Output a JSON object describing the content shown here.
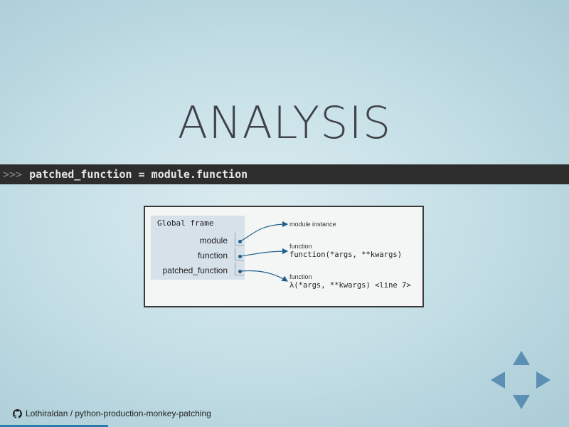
{
  "slide": {
    "title": "ANALYSIS",
    "code": {
      "prompt": ">>>",
      "text": "patched_function = module.function"
    },
    "diagram": {
      "frame_title": "Global frame",
      "variables": [
        "module",
        "function",
        "patched_function"
      ],
      "objects": [
        {
          "type_label": "",
          "value": "module instance"
        },
        {
          "type_label": "function",
          "value": "function(*args, **kwargs)"
        },
        {
          "type_label": "function",
          "value": "λ(*args, **kwargs) <line 7>"
        }
      ]
    }
  },
  "footer": {
    "repo": "Lothiraldan / python-production-monkey-patching",
    "icon": "github-icon"
  },
  "progress": 0.19,
  "colors": {
    "accent": "#2a7cb0",
    "nav_arrow": "#5b8fb3",
    "code_bar": "#2d2d2d",
    "pointer": "#1f5f8b"
  }
}
